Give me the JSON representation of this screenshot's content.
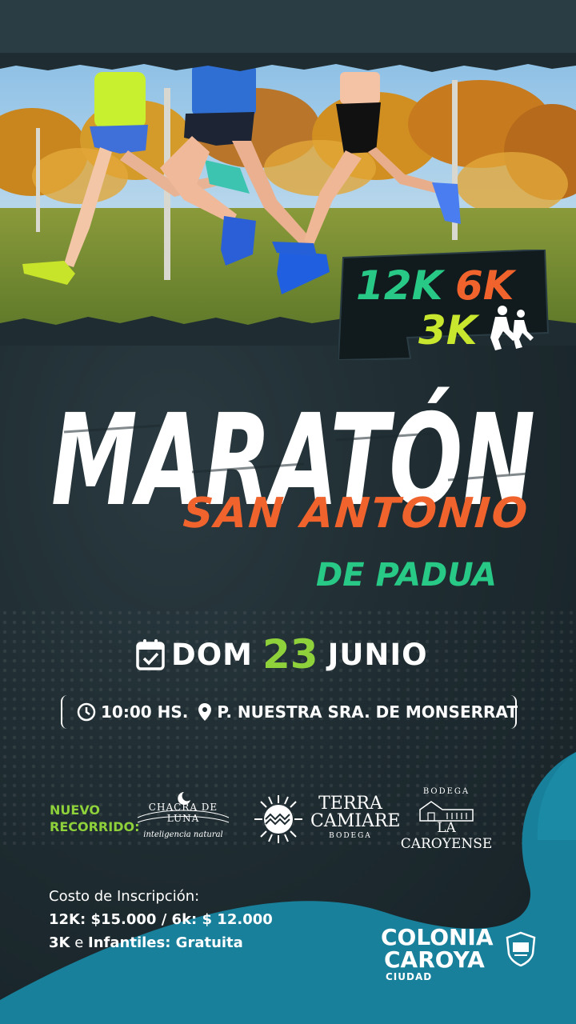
{
  "distances": {
    "d12": "12K",
    "d6": "6K",
    "d3": "3K"
  },
  "title": {
    "main": "MARATÓN",
    "line2": "SAN ANTONIO",
    "line3": "DE PADUA"
  },
  "date": {
    "weekday": "DOM",
    "day": "23",
    "month": "JUNIO"
  },
  "info": {
    "time": "10:00 HS.",
    "place": "P. NUESTRA SRA. DE MONSERRAT"
  },
  "route": {
    "line1": "NUEVO",
    "line2": "RECORRIDO:"
  },
  "sponsors": [
    {
      "name": "CHACRA DE LUNA",
      "tagline": "inteligencia natural"
    },
    {
      "name": "TERRA CAMIARE",
      "tagline": "BODEGA"
    },
    {
      "tagline": "BODEGA",
      "name": "LA CAROYENSE"
    }
  ],
  "cost": {
    "heading": "Costo de Inscripción:",
    "line1": "12K: $15.000 / 6k: $ 12.000",
    "line2_a": "3K",
    "line2_b": "e",
    "line2_c": "Infantiles: Gratuita"
  },
  "logo": {
    "line1": "COLONIA",
    "line2": "CAROYA",
    "line3": "CIUDAD"
  },
  "colors": {
    "orange": "#f0632c",
    "green": "#28c986",
    "lime": "#8ed13a",
    "teal": "#1a7f9a",
    "dark": "#1d2a2f"
  }
}
